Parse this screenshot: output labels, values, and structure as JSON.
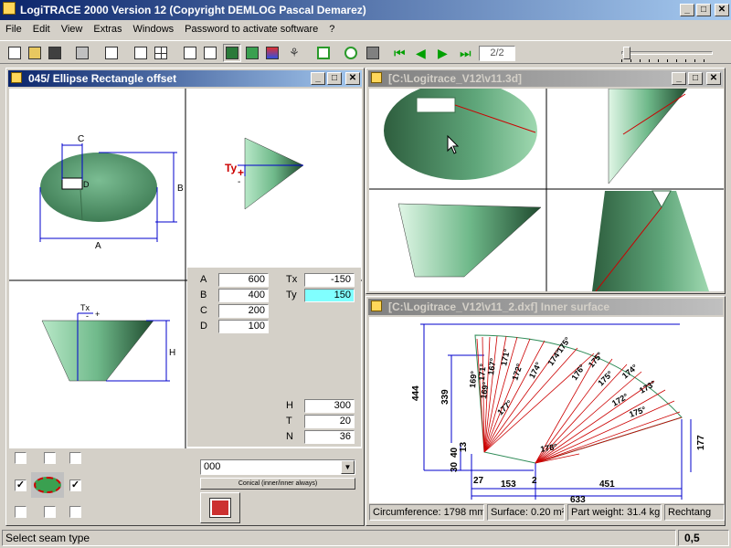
{
  "app": {
    "title": "LogiTRACE 2000  Version 12  (Copyright DEMLOG Pascal Demarez)"
  },
  "window_buttons": {
    "minimize": "_",
    "maximize": "□",
    "close": "✕"
  },
  "menu": [
    "File",
    "Edit",
    "View",
    "Extras",
    "Windows",
    "Password to activate software",
    "?"
  ],
  "toolbar": {
    "page_indicator": "2/2",
    "icons": [
      "new-icon",
      "open-icon",
      "save-icon",
      "print-icon",
      "copy-icon",
      "layout-single-icon",
      "layout-quad-icon",
      "wireframe-icon",
      "solid-icon",
      "shaded-green-icon",
      "shaded-color-icon",
      "palette-icon",
      "tree-icon",
      "fit-icon",
      "curve-icon",
      "info-icon",
      "first-icon",
      "prev-icon",
      "next-icon",
      "last-icon"
    ]
  },
  "left_window": {
    "title": "045/ Ellipse Rectangle offset",
    "dims": {
      "c": "C",
      "b": "B",
      "a": "A",
      "d": "D",
      "h": "H",
      "tx": "Tx",
      "ty": "Ty",
      "plus": "+",
      "minus": "-"
    },
    "params": [
      {
        "label": "A",
        "value": "600"
      },
      {
        "label": "B",
        "value": "400"
      },
      {
        "label": "C",
        "value": "200"
      },
      {
        "label": "D",
        "value": "100"
      }
    ],
    "offsets": [
      {
        "label": "Tx",
        "value": "-150"
      },
      {
        "label": "Ty",
        "value": "150"
      }
    ],
    "extra": [
      {
        "label": "H",
        "value": "300"
      },
      {
        "label": "T",
        "value": "20"
      },
      {
        "label": "N",
        "value": "36"
      }
    ],
    "seam_select": "000",
    "seam_button": "Conical (inner/inner always)",
    "checkboxes": {
      "top": [
        false,
        false,
        false
      ],
      "middle_left": true,
      "middle_right": true,
      "bottom": [
        false,
        false,
        false
      ]
    }
  },
  "right_top_window": {
    "title": "[C:\\Logitrace_V12\\v11.3d]"
  },
  "right_bottom_window": {
    "title": "[C:\\Logitrace_V12\\v11_2.dxf]  Inner surface",
    "dims": {
      "vertical_left": "444",
      "vertical_inner": "339",
      "small_40": "40",
      "small_13": "13",
      "small_30": "30",
      "right_177": "177",
      "bottom_27": "27",
      "bottom_153": "153",
      "bottom_2": "2",
      "bottom_451": "451",
      "bottom_633": "633"
    },
    "angle_labels_left": [
      "169°",
      "171°",
      "167°",
      "169°",
      "171°",
      "172°",
      "174°",
      "177°"
    ],
    "angle_labels_right": [
      "174°",
      "175°",
      "176°",
      "175°",
      "175°",
      "174°",
      "173°",
      "172°",
      "175°",
      "178°"
    ],
    "info": [
      {
        "name": "circumference",
        "text": "Circumference: 1798 mm"
      },
      {
        "name": "surface",
        "text": "Surface: 0.20 m²"
      },
      {
        "name": "part-weight",
        "text": "Part weight: 31.4 kg"
      },
      {
        "name": "shape",
        "text": "Rechtang"
      }
    ]
  },
  "status": {
    "message": "Select seam type",
    "value": "0,5"
  },
  "colors": {
    "title_active": "#0a246a",
    "cone_green": "#5fa67a",
    "highlight_field": "#80ffff",
    "dimension_blue": "#0000cc",
    "angle_red": "#cc0000"
  }
}
